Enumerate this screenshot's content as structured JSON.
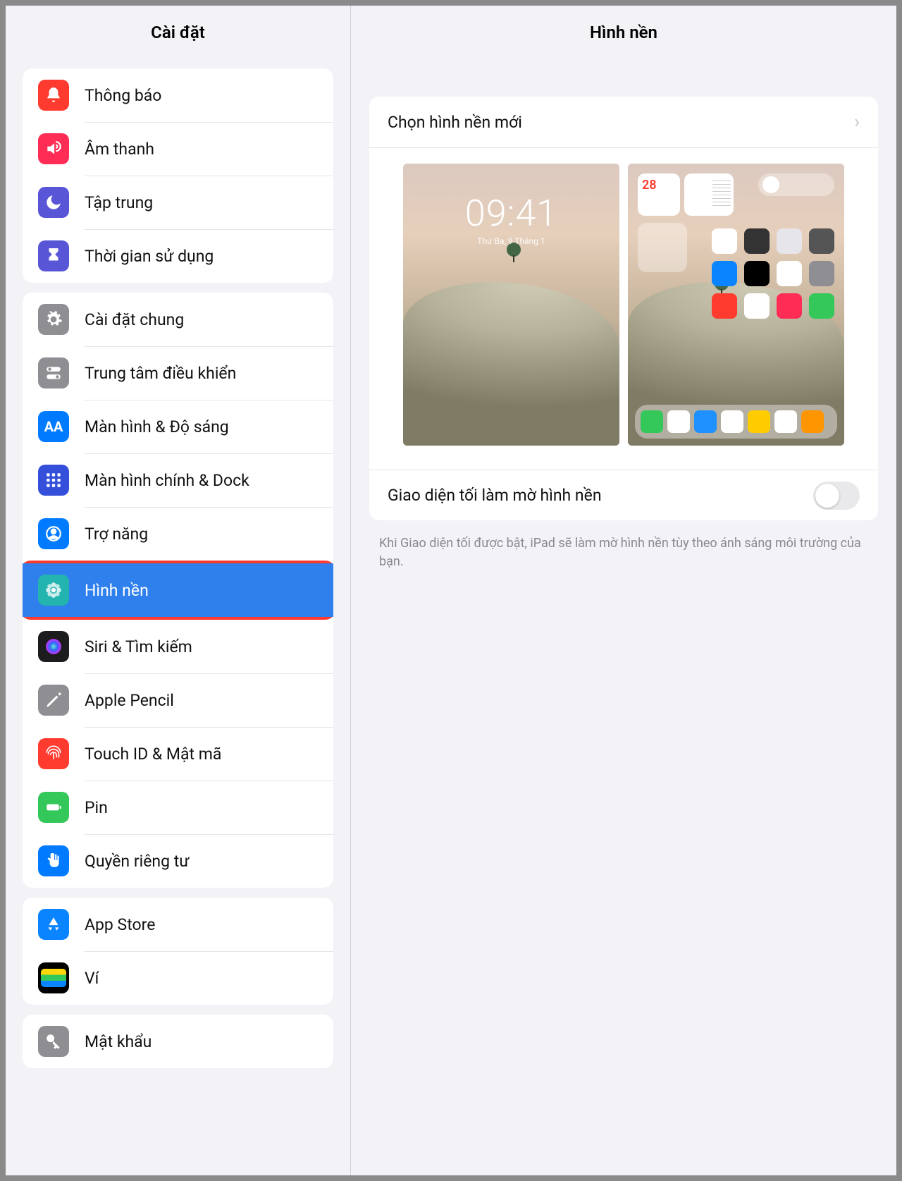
{
  "sidebar": {
    "title": "Cài đặt",
    "groups": [
      {
        "items": [
          {
            "id": "notifications",
            "label": "Thông báo",
            "color": "#ff3b30",
            "icon": "bell"
          },
          {
            "id": "sound",
            "label": "Âm thanh",
            "color": "#ff2d55",
            "icon": "speaker"
          },
          {
            "id": "focus",
            "label": "Tập trung",
            "color": "#5856d6",
            "icon": "moon"
          },
          {
            "id": "screentime",
            "label": "Thời gian sử dụng",
            "color": "#5856d6",
            "icon": "hourglass"
          }
        ]
      },
      {
        "items": [
          {
            "id": "general",
            "label": "Cài đặt chung",
            "color": "#8e8e93",
            "icon": "gear"
          },
          {
            "id": "control-center",
            "label": "Trung tâm điều khiển",
            "color": "#8e8e93",
            "icon": "switches"
          },
          {
            "id": "display",
            "label": "Màn hình & Độ sáng",
            "color": "#007aff",
            "icon": "AA"
          },
          {
            "id": "home-dock",
            "label": "Màn hình chính & Dock",
            "color": "#3450db",
            "icon": "grid"
          },
          {
            "id": "accessibility",
            "label": "Trợ năng",
            "color": "#007aff",
            "icon": "person"
          },
          {
            "id": "wallpaper",
            "label": "Hình nền",
            "color": "#23b4b0",
            "icon": "flower",
            "selected": true,
            "highlighted": true
          },
          {
            "id": "siri",
            "label": "Siri & Tìm kiếm",
            "color": "#1c1c1e",
            "icon": "siri"
          },
          {
            "id": "pencil",
            "label": "Apple Pencil",
            "color": "#8e8e93",
            "icon": "pencil"
          },
          {
            "id": "touchid",
            "label": "Touch ID & Mật mã",
            "color": "#ff3b30",
            "icon": "fingerprint"
          },
          {
            "id": "battery",
            "label": "Pin",
            "color": "#34c759",
            "icon": "battery"
          },
          {
            "id": "privacy",
            "label": "Quyền riêng tư",
            "color": "#007aff",
            "icon": "hand"
          }
        ]
      },
      {
        "items": [
          {
            "id": "appstore",
            "label": "App Store",
            "color": "#0a84ff",
            "icon": "appstore"
          },
          {
            "id": "wallet",
            "label": "Ví",
            "color": "#000",
            "icon": "wallet"
          }
        ]
      },
      {
        "items": [
          {
            "id": "passwords",
            "label": "Mật khẩu",
            "color": "#8e8e93",
            "icon": "key"
          }
        ]
      }
    ]
  },
  "detail": {
    "title": "Hình nền",
    "choose_label": "Chọn hình nền mới",
    "lock_preview": {
      "time": "09:41",
      "date": "Thứ Ba, 9 Tháng 1"
    },
    "home_preview": {
      "calendar_day": "28"
    },
    "dim_toggle": {
      "label": "Giao diện tối làm mờ hình nền",
      "on": false
    },
    "footnote": "Khi Giao diện tối được bật, iPad sẽ làm mờ hình nền tùy theo ánh sáng môi trường của bạn."
  }
}
